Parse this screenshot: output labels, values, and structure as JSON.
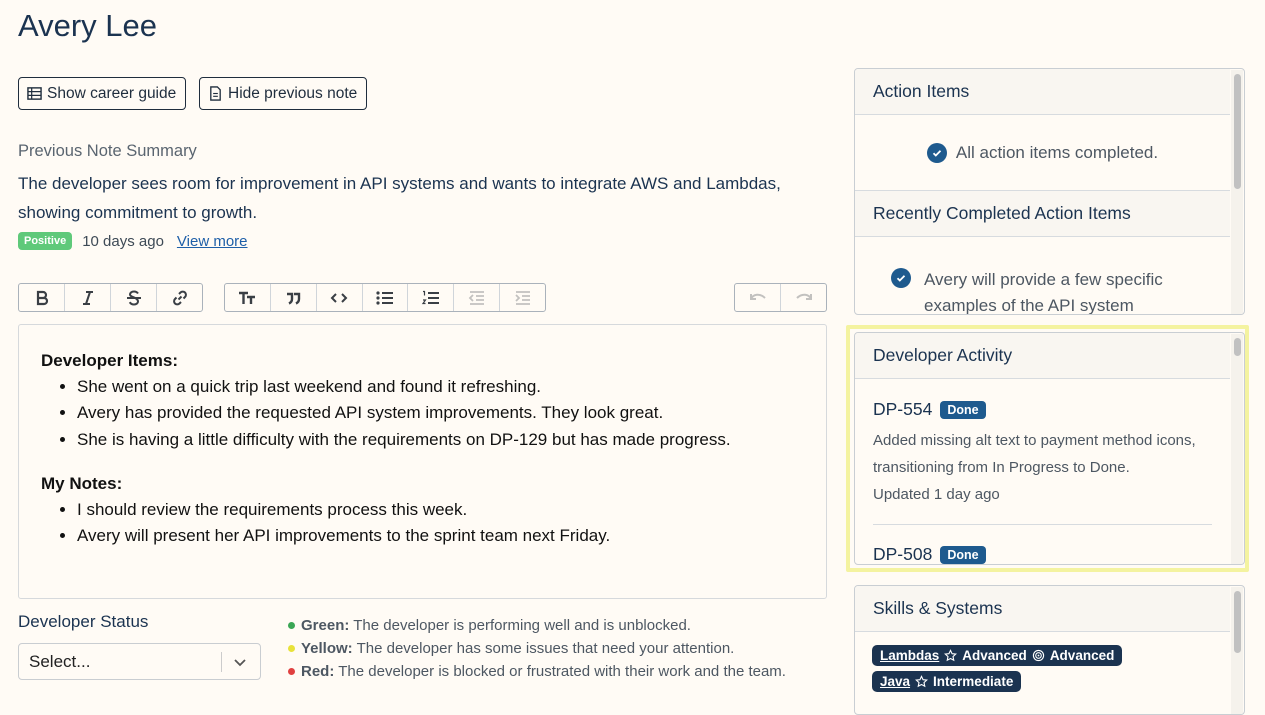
{
  "page_title": "Avery Lee",
  "buttons": {
    "career_guide": "Show career guide",
    "hide_note": "Hide previous note"
  },
  "previous_note": {
    "label": "Previous Note Summary",
    "text": "The developer sees room for improvement in API systems and wants to integrate AWS and Lambdas, showing commitment to growth.",
    "sentiment": "Positive",
    "ago": "10 days ago",
    "view_more": "View more"
  },
  "toolbar": {
    "groups": [
      [
        "bold-icon",
        "italic-icon",
        "strikethrough-icon",
        "link-icon"
      ],
      [
        "heading-icon",
        "quote-icon",
        "code-icon",
        "bullet-list-icon",
        "numbered-list-icon",
        "outdent-icon",
        "indent-icon"
      ],
      [
        "undo-icon",
        "redo-icon"
      ]
    ]
  },
  "editor": {
    "developer_items_heading": "Developer Items:",
    "developer_items": [
      "She went on a quick trip last weekend and found it refreshing.",
      "Avery has provided the requested API system improvements. They look great.",
      "She is having a little difficulty with the requirements on DP-129 but has made progress."
    ],
    "my_notes_heading": "My Notes:",
    "my_notes": [
      "I should review the requirements process this week.",
      "Avery will present her API improvements to the sprint team next Friday."
    ]
  },
  "developer_status": {
    "label": "Developer Status",
    "select_value": "Select...",
    "legend": [
      {
        "name": "Green:",
        "text": "The developer is performing well and is unblocked.",
        "color": "#3aa655"
      },
      {
        "name": "Yellow:",
        "text": "The developer has some issues that need your attention.",
        "color": "#e8e23a"
      },
      {
        "name": "Red:",
        "text": "The developer is blocked or frustrated with their work and the team.",
        "color": "#e04040"
      }
    ]
  },
  "action_items": {
    "title": "Action Items",
    "status": "All action items completed.",
    "recent_title": "Recently Completed Action Items",
    "recent": [
      "Avery will provide a few specific examples of the API system"
    ]
  },
  "developer_activity": {
    "title": "Developer Activity",
    "items": [
      {
        "id": "DP-554",
        "status": "Done",
        "desc1": "Added missing alt text to payment method icons,",
        "desc2": "transitioning from In Progress to Done.",
        "updated": "Updated 1 day ago"
      },
      {
        "id": "DP-508",
        "status": "Done"
      }
    ]
  },
  "skills": {
    "title": "Skills & Systems",
    "items": [
      {
        "name": "Lambdas",
        "level1": "Advanced",
        "level2": "Advanced"
      },
      {
        "name": "Java",
        "level1": "Intermediate"
      }
    ]
  },
  "colors": {
    "background": "#fffbf5",
    "brand_navy": "#1b3350",
    "done_badge": "#1e5a8e",
    "positive_badge": "#5fc97a",
    "highlight": "#f4f3a0"
  }
}
